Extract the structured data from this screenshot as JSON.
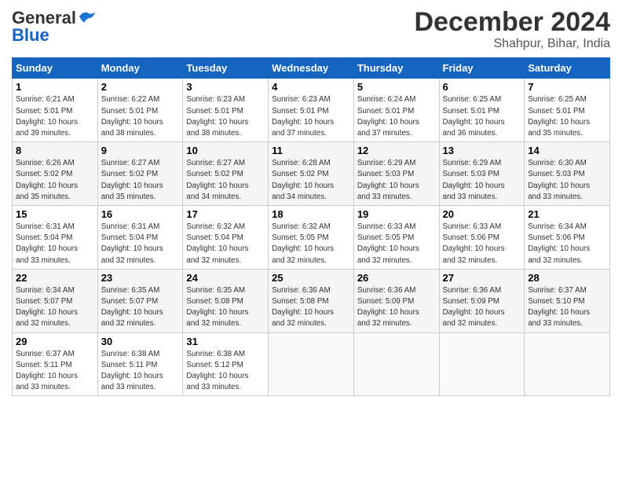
{
  "logo": {
    "part1": "General",
    "part2": "Blue"
  },
  "header": {
    "month": "December 2024",
    "location": "Shahpur, Bihar, India"
  },
  "weekdays": [
    "Sunday",
    "Monday",
    "Tuesday",
    "Wednesday",
    "Thursday",
    "Friday",
    "Saturday"
  ],
  "weeks": [
    [
      {
        "day": "1",
        "info": "Sunrise: 6:21 AM\nSunset: 5:01 PM\nDaylight: 10 hours\nand 39 minutes."
      },
      {
        "day": "2",
        "info": "Sunrise: 6:22 AM\nSunset: 5:01 PM\nDaylight: 10 hours\nand 38 minutes."
      },
      {
        "day": "3",
        "info": "Sunrise: 6:23 AM\nSunset: 5:01 PM\nDaylight: 10 hours\nand 38 minutes."
      },
      {
        "day": "4",
        "info": "Sunrise: 6:23 AM\nSunset: 5:01 PM\nDaylight: 10 hours\nand 37 minutes."
      },
      {
        "day": "5",
        "info": "Sunrise: 6:24 AM\nSunset: 5:01 PM\nDaylight: 10 hours\nand 37 minutes."
      },
      {
        "day": "6",
        "info": "Sunrise: 6:25 AM\nSunset: 5:01 PM\nDaylight: 10 hours\nand 36 minutes."
      },
      {
        "day": "7",
        "info": "Sunrise: 6:25 AM\nSunset: 5:01 PM\nDaylight: 10 hours\nand 35 minutes."
      }
    ],
    [
      {
        "day": "8",
        "info": "Sunrise: 6:26 AM\nSunset: 5:02 PM\nDaylight: 10 hours\nand 35 minutes."
      },
      {
        "day": "9",
        "info": "Sunrise: 6:27 AM\nSunset: 5:02 PM\nDaylight: 10 hours\nand 35 minutes."
      },
      {
        "day": "10",
        "info": "Sunrise: 6:27 AM\nSunset: 5:02 PM\nDaylight: 10 hours\nand 34 minutes."
      },
      {
        "day": "11",
        "info": "Sunrise: 6:28 AM\nSunset: 5:02 PM\nDaylight: 10 hours\nand 34 minutes."
      },
      {
        "day": "12",
        "info": "Sunrise: 6:29 AM\nSunset: 5:03 PM\nDaylight: 10 hours\nand 33 minutes."
      },
      {
        "day": "13",
        "info": "Sunrise: 6:29 AM\nSunset: 5:03 PM\nDaylight: 10 hours\nand 33 minutes."
      },
      {
        "day": "14",
        "info": "Sunrise: 6:30 AM\nSunset: 5:03 PM\nDaylight: 10 hours\nand 33 minutes."
      }
    ],
    [
      {
        "day": "15",
        "info": "Sunrise: 6:31 AM\nSunset: 5:04 PM\nDaylight: 10 hours\nand 33 minutes."
      },
      {
        "day": "16",
        "info": "Sunrise: 6:31 AM\nSunset: 5:04 PM\nDaylight: 10 hours\nand 32 minutes."
      },
      {
        "day": "17",
        "info": "Sunrise: 6:32 AM\nSunset: 5:04 PM\nDaylight: 10 hours\nand 32 minutes."
      },
      {
        "day": "18",
        "info": "Sunrise: 6:32 AM\nSunset: 5:05 PM\nDaylight: 10 hours\nand 32 minutes."
      },
      {
        "day": "19",
        "info": "Sunrise: 6:33 AM\nSunset: 5:05 PM\nDaylight: 10 hours\nand 32 minutes."
      },
      {
        "day": "20",
        "info": "Sunrise: 6:33 AM\nSunset: 5:06 PM\nDaylight: 10 hours\nand 32 minutes."
      },
      {
        "day": "21",
        "info": "Sunrise: 6:34 AM\nSunset: 5:06 PM\nDaylight: 10 hours\nand 32 minutes."
      }
    ],
    [
      {
        "day": "22",
        "info": "Sunrise: 6:34 AM\nSunset: 5:07 PM\nDaylight: 10 hours\nand 32 minutes."
      },
      {
        "day": "23",
        "info": "Sunrise: 6:35 AM\nSunset: 5:07 PM\nDaylight: 10 hours\nand 32 minutes."
      },
      {
        "day": "24",
        "info": "Sunrise: 6:35 AM\nSunset: 5:08 PM\nDaylight: 10 hours\nand 32 minutes."
      },
      {
        "day": "25",
        "info": "Sunrise: 6:36 AM\nSunset: 5:08 PM\nDaylight: 10 hours\nand 32 minutes."
      },
      {
        "day": "26",
        "info": "Sunrise: 6:36 AM\nSunset: 5:09 PM\nDaylight: 10 hours\nand 32 minutes."
      },
      {
        "day": "27",
        "info": "Sunrise: 6:36 AM\nSunset: 5:09 PM\nDaylight: 10 hours\nand 32 minutes."
      },
      {
        "day": "28",
        "info": "Sunrise: 6:37 AM\nSunset: 5:10 PM\nDaylight: 10 hours\nand 33 minutes."
      }
    ],
    [
      {
        "day": "29",
        "info": "Sunrise: 6:37 AM\nSunset: 5:11 PM\nDaylight: 10 hours\nand 33 minutes."
      },
      {
        "day": "30",
        "info": "Sunrise: 6:38 AM\nSunset: 5:11 PM\nDaylight: 10 hours\nand 33 minutes."
      },
      {
        "day": "31",
        "info": "Sunrise: 6:38 AM\nSunset: 5:12 PM\nDaylight: 10 hours\nand 33 minutes."
      },
      {
        "day": "",
        "info": ""
      },
      {
        "day": "",
        "info": ""
      },
      {
        "day": "",
        "info": ""
      },
      {
        "day": "",
        "info": ""
      }
    ]
  ]
}
